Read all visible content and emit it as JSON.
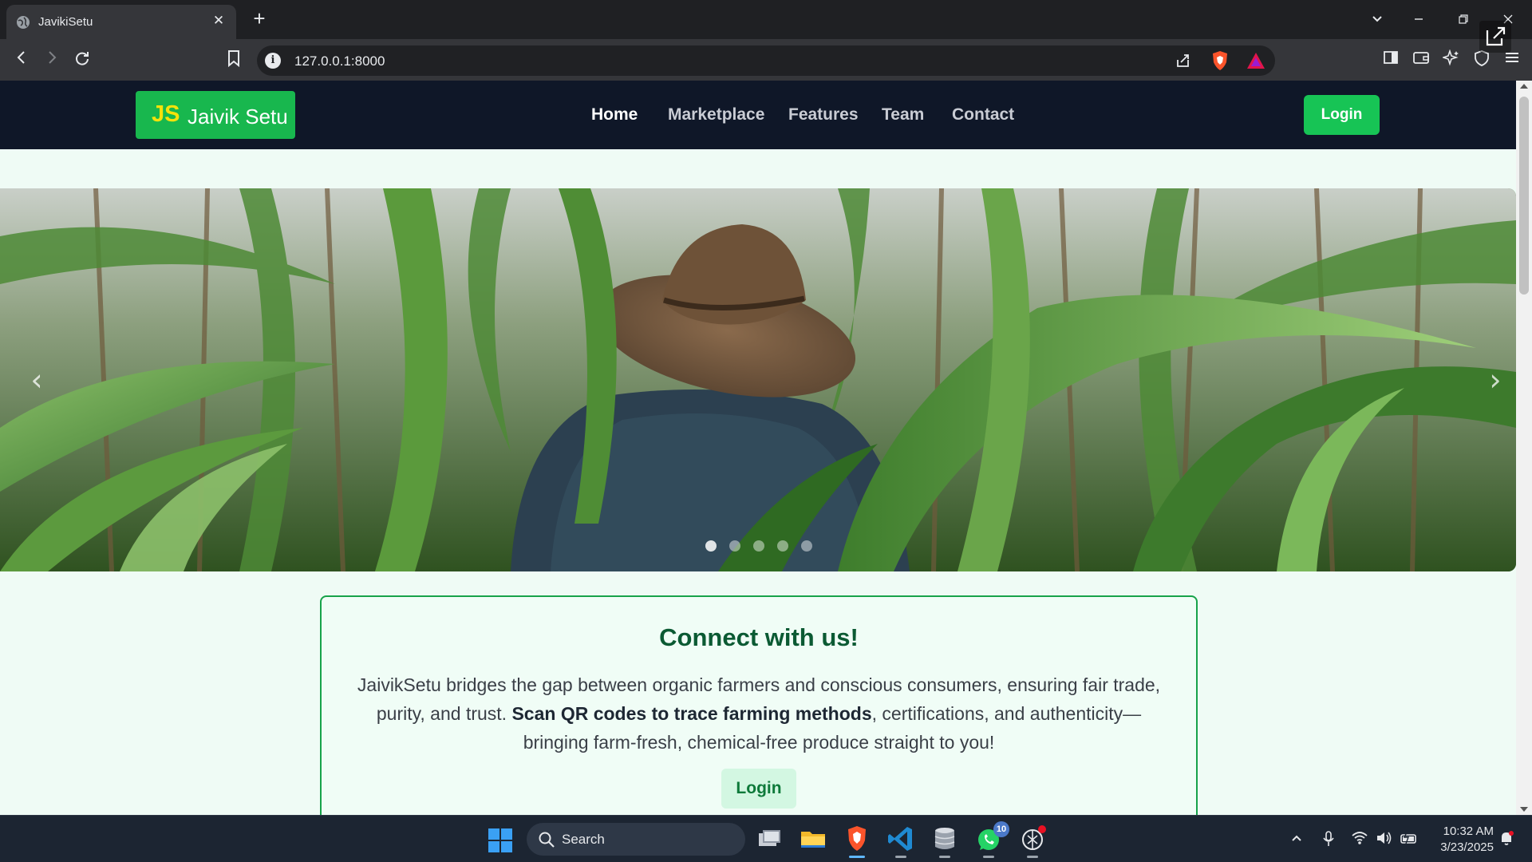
{
  "browser": {
    "tab_title": "JavikiSetu",
    "tab_close": "✕",
    "new_tab": "+",
    "url": "127.0.0.1:8000"
  },
  "navbar": {
    "logo_initials": "JS",
    "logo_name": "Jaivik Setu",
    "links": [
      "Home",
      "Marketplace",
      "Features",
      "Team",
      "Contact"
    ],
    "active_link": "Home",
    "login_label": "Login"
  },
  "hero": {
    "prev_label": "‹",
    "next_label": "›",
    "slide_count": 5,
    "active_slide": 1
  },
  "card": {
    "title": "Connect with us!",
    "text_before": "JaivikSetu bridges the gap between organic farmers and conscious consumers, ensuring fair trade, purity, and trust. ",
    "text_bold": "Scan QR codes to trace farming methods",
    "text_after": ", certifications, and authenticity—bringing farm-fresh, chemical-free produce straight to you!",
    "login_label": "Login"
  },
  "taskbar": {
    "search_label": "Search",
    "whatsapp_badge": "10",
    "time": "10:32 AM",
    "date": "3/23/2025"
  },
  "colors": {
    "navbar_bg": "#0f1728",
    "brand_green": "#18b74e",
    "login_green": "#17c455",
    "page_bg": "#effbf5",
    "card_title": "#0b5a33"
  }
}
